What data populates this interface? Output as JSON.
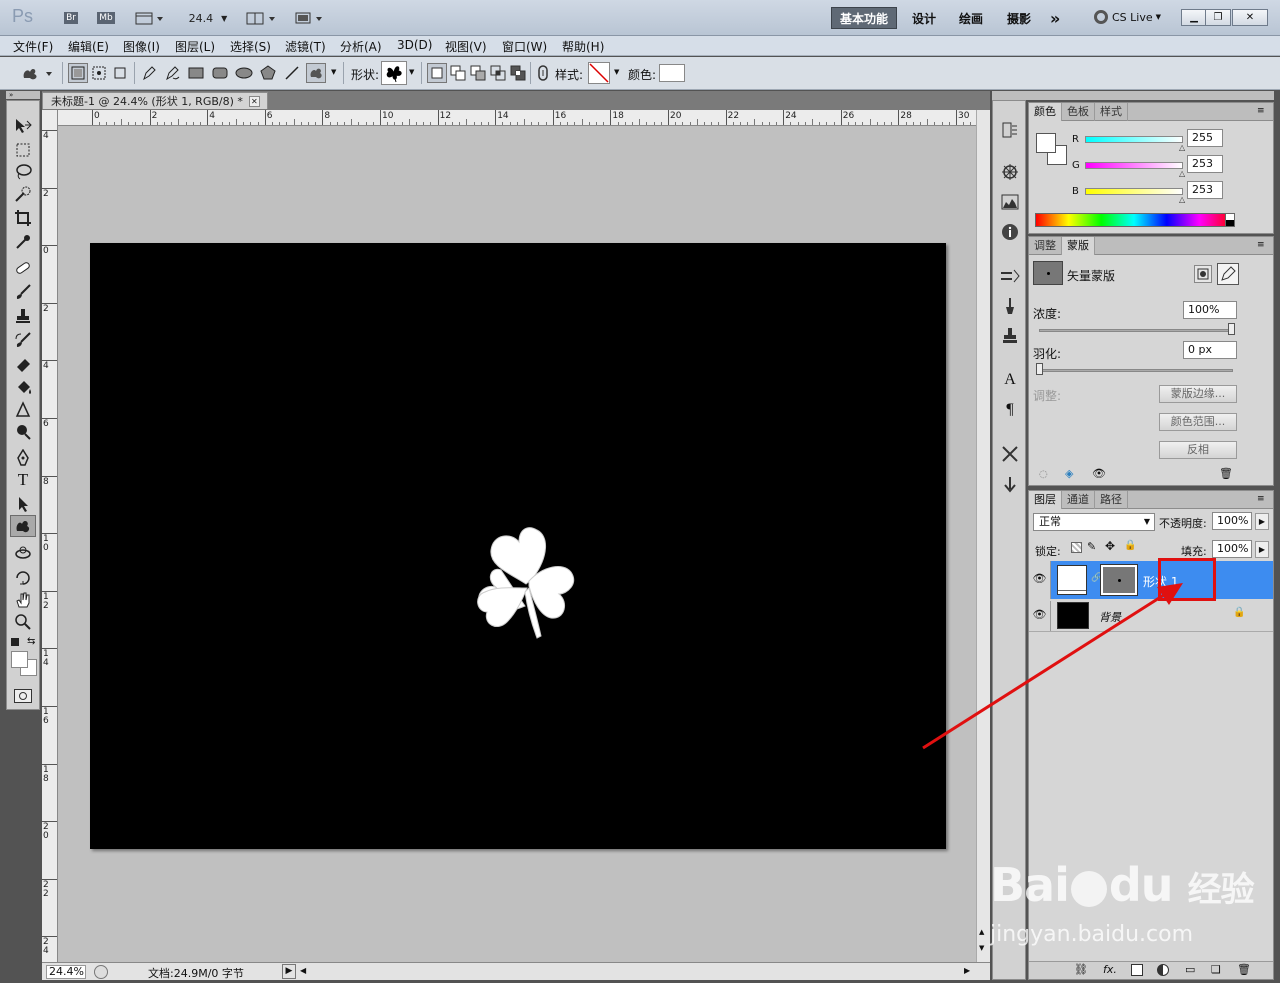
{
  "titlebar": {
    "app_logo": "Ps",
    "br": "Br",
    "mb": "Mb",
    "zoom": "24.4",
    "workspaces": [
      "基本功能",
      "设计",
      "绘画",
      "摄影"
    ],
    "more": "»",
    "cs_live": "CS Live"
  },
  "menu": [
    "文件(F)",
    "编辑(E)",
    "图像(I)",
    "图层(L)",
    "选择(S)",
    "滤镜(T)",
    "分析(A)",
    "3D(D)",
    "视图(V)",
    "窗口(W)",
    "帮助(H)"
  ],
  "options": {
    "shape_label": "形状:",
    "style_label": "样式:",
    "color_label": "颜色:"
  },
  "document": {
    "tab_title": "未标题-1 @ 24.4% (形状 1, RGB/8) *",
    "ruler_h": [
      "0",
      "2",
      "4",
      "6",
      "8",
      "10",
      "12",
      "14",
      "16",
      "18",
      "20",
      "22",
      "24",
      "26",
      "28",
      "30"
    ],
    "ruler_v": [
      "4",
      "2",
      "0",
      "2",
      "4",
      "6",
      "8",
      "10",
      "12",
      "14",
      "16",
      "18",
      "20",
      "22",
      "24"
    ]
  },
  "status": {
    "zoom": "24.4%",
    "doc_info": "文档:24.9M/0 字节"
  },
  "color_panel": {
    "tabs": [
      "颜色",
      "色板",
      "样式"
    ],
    "r_label": "R",
    "r_value": "255",
    "g_label": "G",
    "g_value": "253",
    "b_label": "B",
    "b_value": "253"
  },
  "mask_panel": {
    "tabs": [
      "调整",
      "蒙版"
    ],
    "mask_type": "矢量蒙版",
    "density_label": "浓度:",
    "density_value": "100%",
    "feather_label": "羽化:",
    "feather_value": "0 px",
    "adjust_label": "调整:",
    "btn_edge": "蒙版边缘...",
    "btn_range": "颜色范围...",
    "btn_invert": "反相"
  },
  "layers_panel": {
    "tabs": [
      "图层",
      "通道",
      "路径"
    ],
    "blend_mode": "正常",
    "opacity_label": "不透明度:",
    "opacity_value": "100%",
    "lock_label": "锁定:",
    "fill_label": "填充:",
    "fill_value": "100%",
    "layers": [
      {
        "name": "形状 1",
        "selected": true
      },
      {
        "name": "背景",
        "selected": false
      }
    ]
  },
  "watermark": {
    "brand": "Bai",
    "brand2": "du",
    "cn": "经验",
    "url": "jingyan.baidu.com"
  },
  "colors": {
    "selection": "#3d8cf0",
    "highlight_box": "#e01010",
    "arrow": "#e01010"
  }
}
